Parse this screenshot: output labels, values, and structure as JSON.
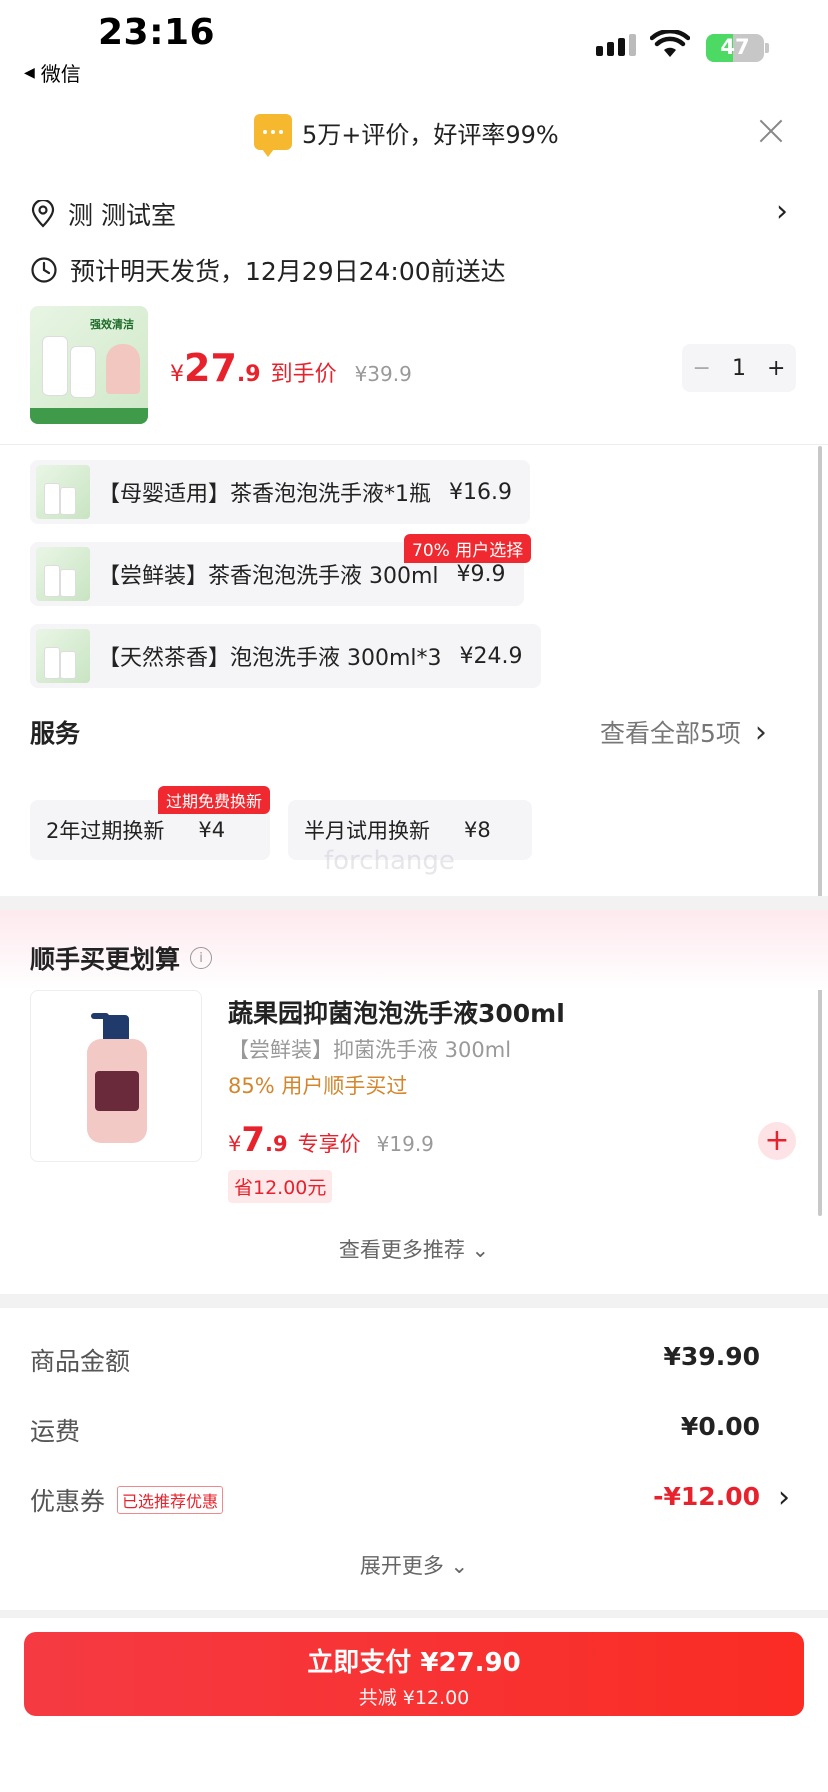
{
  "status_bar": {
    "time": "23:16",
    "back_label": "微信",
    "battery": "47"
  },
  "banner": {
    "rating": "5万+评价，好评率99%"
  },
  "address": {
    "text": "测 测试室"
  },
  "delivery": {
    "text": "预计明天发货，12月29日24:00前送达"
  },
  "product": {
    "currency": "¥",
    "price_int": "27",
    "price_dec": ".9",
    "price_label": "到手价",
    "original_price": "¥39.9",
    "quantity": "1",
    "minus": "−",
    "plus": "+"
  },
  "sku_options": [
    {
      "label": "【母婴适用】茶香泡泡洗手液*1瓶",
      "price": "¥16.9"
    },
    {
      "label": "【尝鲜装】茶香泡泡洗手液 300ml",
      "price": "¥9.9",
      "badge": "70% 用户选择"
    },
    {
      "label": "【天然茶香】泡泡洗手液 300ml*3",
      "price": "¥24.9"
    }
  ],
  "services": {
    "title": "服务",
    "view_all": "查看全部5项",
    "items": [
      {
        "label": "2年过期换新",
        "price": "¥4",
        "badge": "过期免费换新"
      },
      {
        "label": "半月试用换新",
        "price": "¥8"
      }
    ]
  },
  "watermark": "forchange",
  "bundle": {
    "title": "顺手买更划算",
    "info_icon": "i",
    "name": "蔬果园抑菌泡泡洗手液300ml",
    "spec": "【尝鲜装】抑菌洗手液 300ml",
    "stat": "85% 用户顺手买过",
    "currency": "¥",
    "price_int": "7",
    "price_dec": ".9",
    "price_label": "专享价",
    "original_price": "¥19.9",
    "save": "省12.00元",
    "add": "+",
    "more": "查看更多推荐 ⌄"
  },
  "totals": {
    "goods_label": "商品金额",
    "goods_value": "¥39.90",
    "shipping_label": "运费",
    "shipping_value": "¥0.00",
    "coupon_label": "优惠券",
    "coupon_tag": "已选推荐优惠",
    "coupon_value": "-¥12.00",
    "expand": "展开更多 ⌄"
  },
  "pay": {
    "title": "立即支付 ¥27.90",
    "subtitle": "共减 ¥12.00"
  },
  "colors": {
    "accent": "#e8222c",
    "pay_gradient_start": "#f53a43",
    "pay_gradient_end": "#fa2c24",
    "stat_orange": "#d4862d"
  }
}
